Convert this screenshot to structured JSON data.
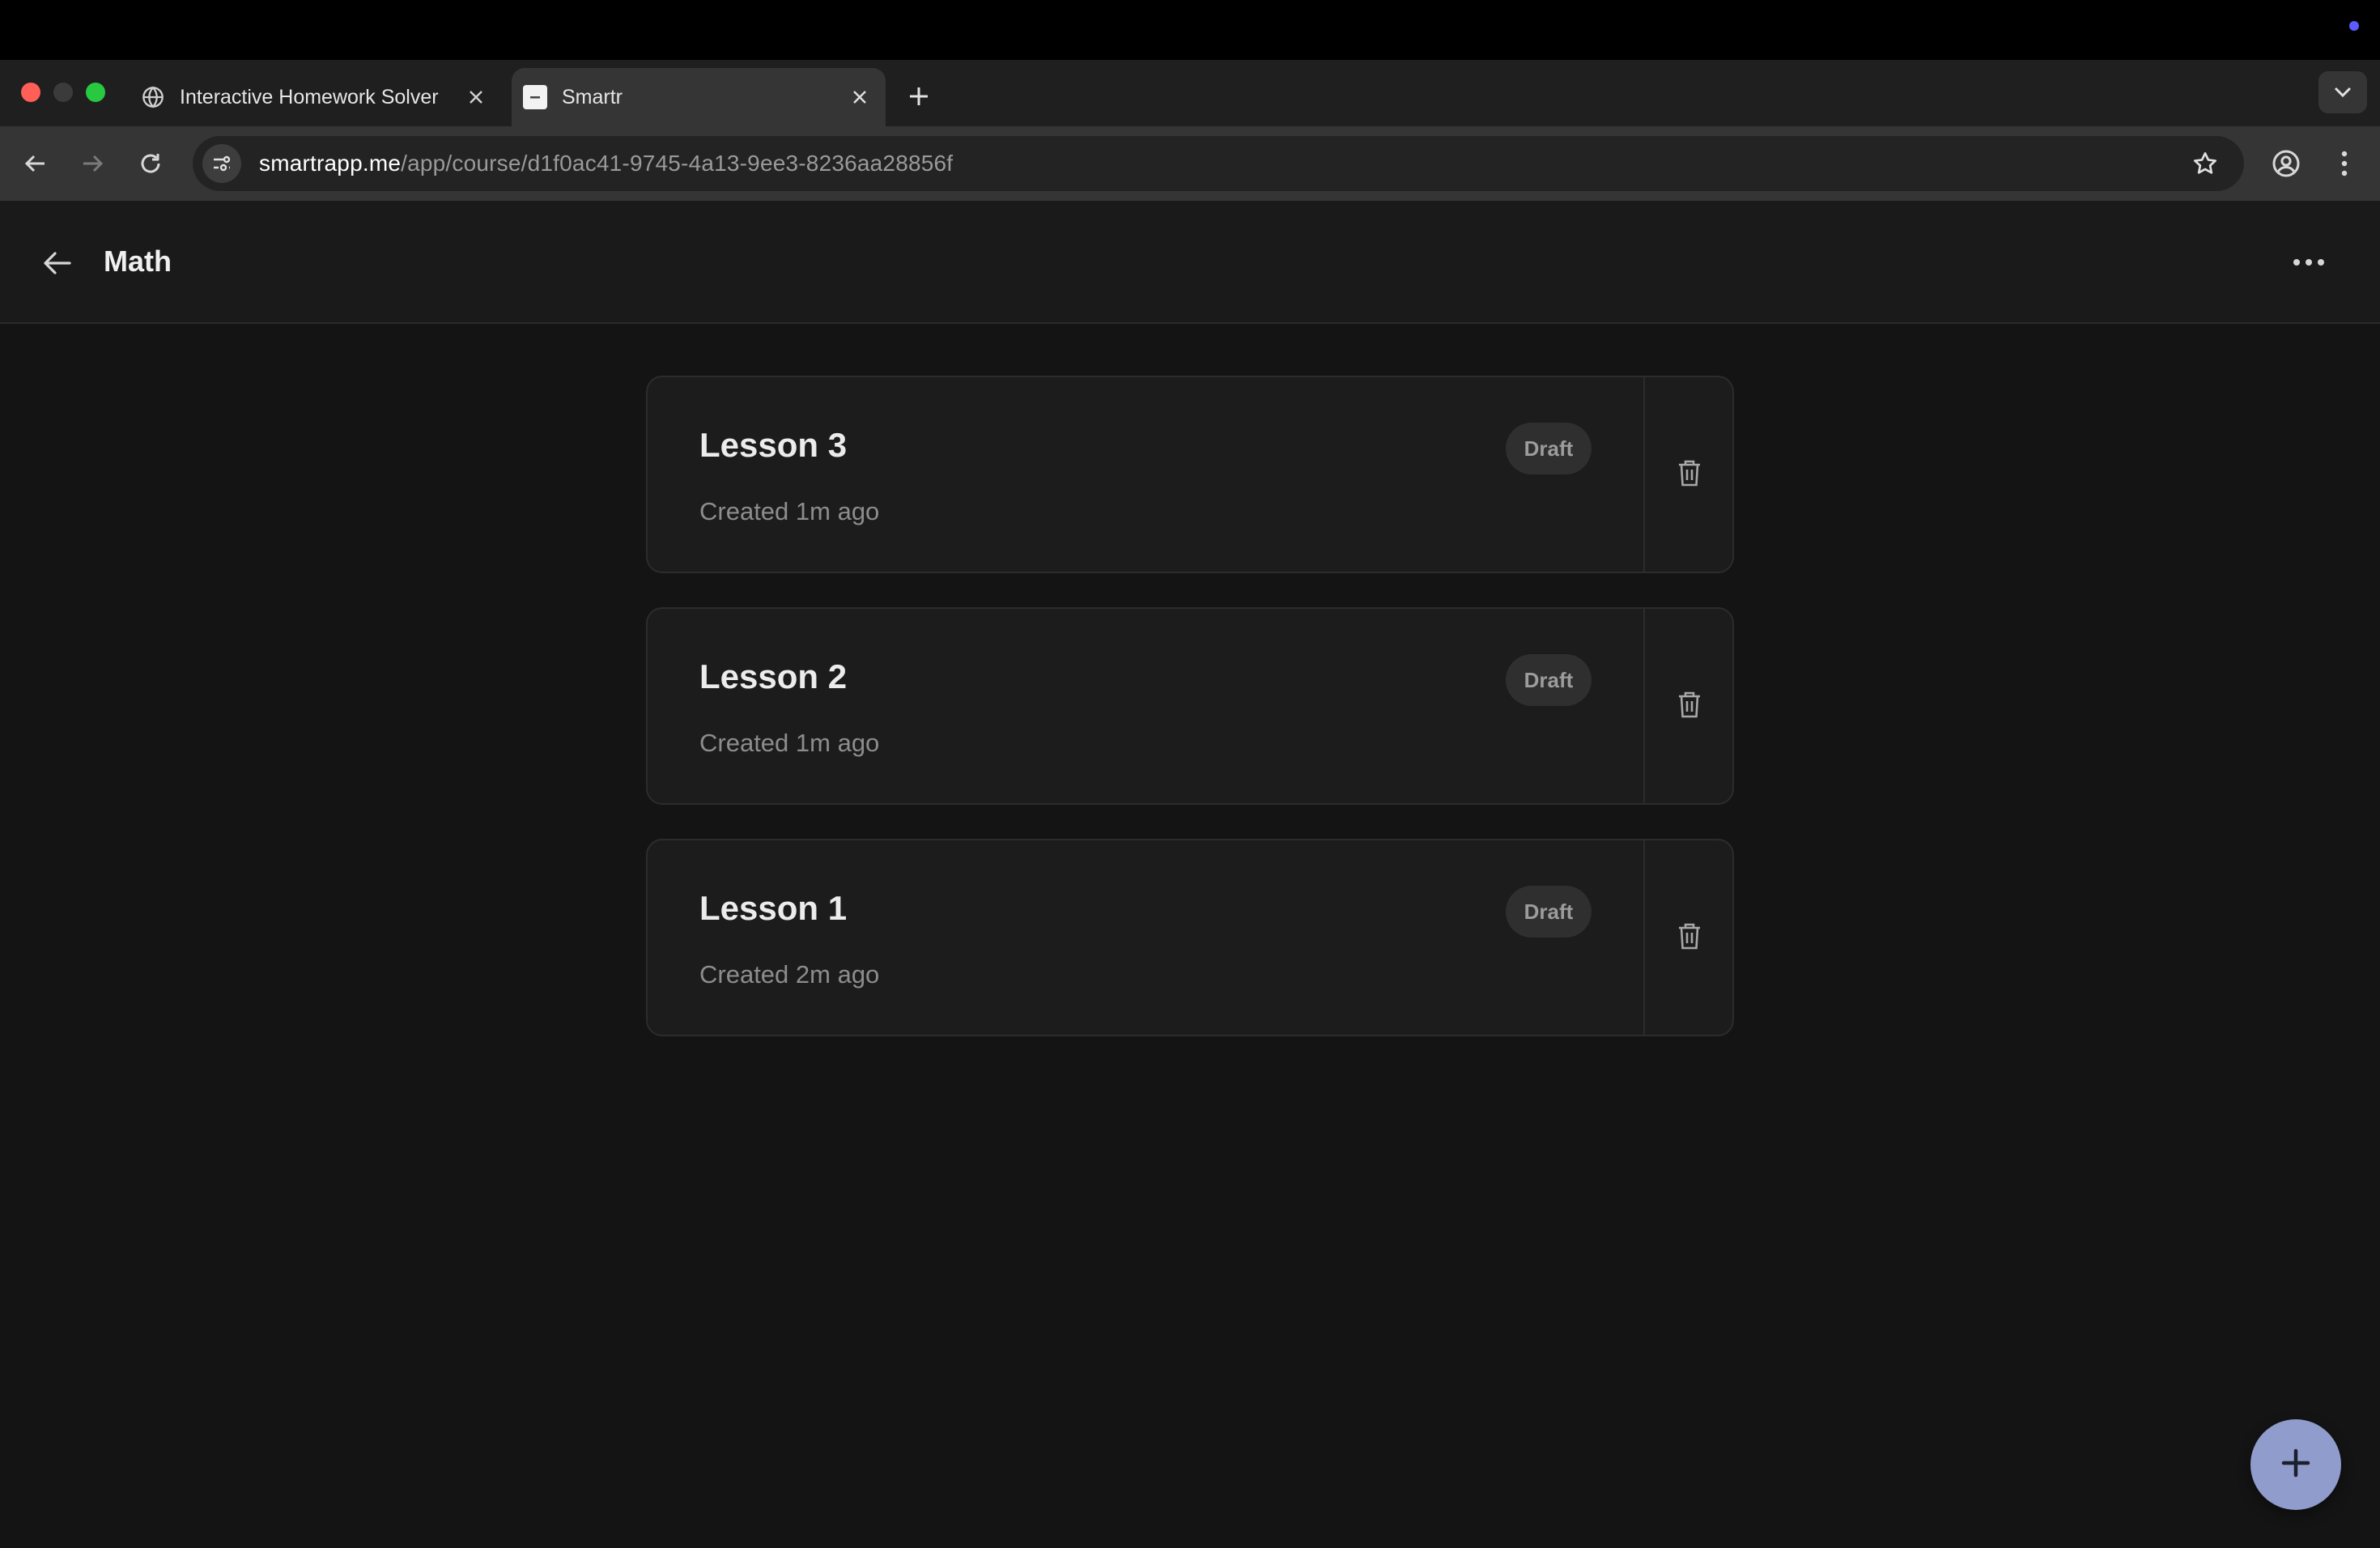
{
  "browser": {
    "tabs": [
      {
        "title": "Interactive Homework Solver",
        "favicon": "globe-icon",
        "active": false
      },
      {
        "title": "Smartr",
        "favicon": "smartr-favicon",
        "active": true
      }
    ],
    "address": {
      "host": "smartrapp.me",
      "path": "/app/course/d1f0ac41-9745-4a13-9ee3-8236aa28856f"
    }
  },
  "header": {
    "title": "Math"
  },
  "lessons": [
    {
      "name": "Lesson 3",
      "created": "Created 1m ago",
      "status": "Draft"
    },
    {
      "name": "Lesson 2",
      "created": "Created 1m ago",
      "status": "Draft"
    },
    {
      "name": "Lesson 1",
      "created": "Created 2m ago",
      "status": "Draft"
    }
  ],
  "colors": {
    "background": "#141414",
    "card": "#1c1c1c",
    "fab": "#8f9ccc",
    "close_button": "#ff5f57",
    "maximize_button": "#28c840"
  }
}
